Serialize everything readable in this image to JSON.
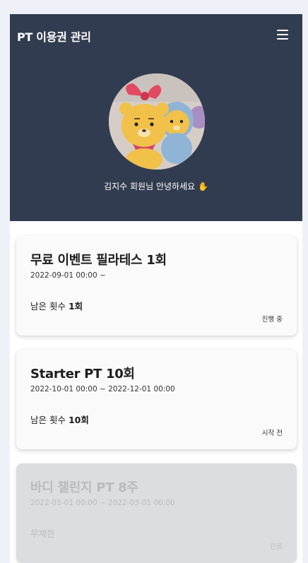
{
  "header": {
    "title": "PT 이용권 관리",
    "menu_icon": "hamburger-menu-icon",
    "background": "#323c50"
  },
  "profile": {
    "avatar_alt": "profile-photo-plush-toys",
    "greeting": "김지수 회원님 안녕하세요 ✋"
  },
  "tickets": [
    {
      "title": "무료 이벤트 필라테스 1회",
      "period": "2022-09-01 00:00 ~",
      "remaining_label": "남은 횟수",
      "remaining_value": "1회",
      "status": "진행 중"
    },
    {
      "title": "Starter PT 10회",
      "period": "2022-10-01 00:00 ~ 2022-12-01 00:00",
      "remaining_label": "남은 횟수",
      "remaining_value": "10회",
      "status": "시작 전"
    },
    {
      "title": "바디 챌린지 PT 8주",
      "period": "2022-01-01 00:00 ~ 2022-03-01 00:00",
      "remaining_label": "무제한",
      "remaining_value": "",
      "status": "만료"
    }
  ]
}
